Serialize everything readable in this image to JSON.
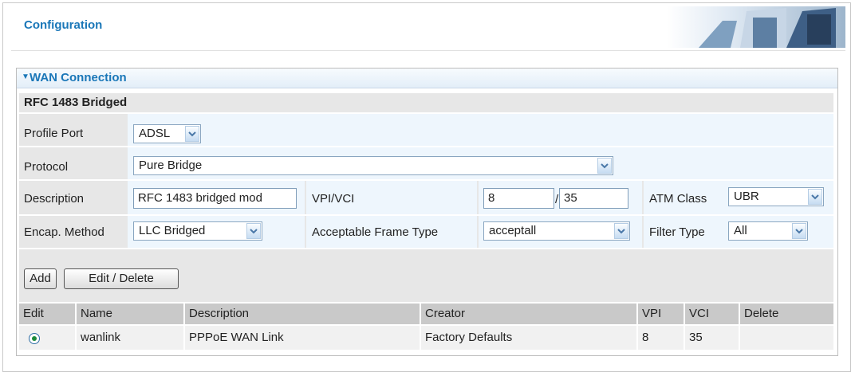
{
  "header": {
    "title": "Configuration"
  },
  "section": {
    "title": "WAN Connection",
    "subtitle": "RFC 1483 Bridged"
  },
  "form": {
    "profile_port": {
      "label": "Profile Port",
      "value": "ADSL"
    },
    "protocol": {
      "label": "Protocol",
      "value": "Pure Bridge"
    },
    "description": {
      "label": "Description",
      "value": "RFC 1483 bridged mod"
    },
    "vpi_vci": {
      "label": "VPI/VCI",
      "vpi": "8",
      "separator": "/",
      "vci": "35"
    },
    "atm_class": {
      "label": "ATM Class",
      "value": "UBR"
    },
    "encap_method": {
      "label": "Encap. Method",
      "value": "LLC Bridged"
    },
    "frame_type": {
      "label": "Acceptable Frame Type",
      "value": "acceptall"
    },
    "filter_type": {
      "label": "Filter Type",
      "value": "All"
    }
  },
  "buttons": {
    "add": "Add",
    "edit_delete": "Edit / Delete"
  },
  "table": {
    "headers": [
      "Edit",
      "Name",
      "Description",
      "Creator",
      "VPI",
      "VCI",
      "Delete"
    ],
    "rows": [
      {
        "name": "wanlink",
        "description": "PPPoE WAN Link",
        "creator": "Factory Defaults",
        "vpi": "8",
        "vci": "35",
        "delete": ""
      }
    ]
  },
  "colors": {
    "accent": "#1a77b8",
    "field_bg": "#eef6fd",
    "band_bg": "#e7e7e7"
  },
  "icons": [
    "collapse-arrow-icon",
    "chevron-down-icon",
    "radio-selected-icon",
    "banner-image"
  ]
}
